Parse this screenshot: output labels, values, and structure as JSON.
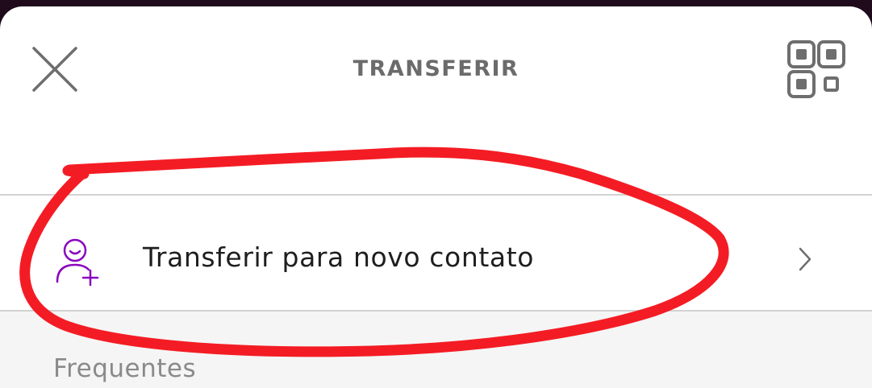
{
  "header": {
    "title": "TRANSFERIR",
    "close_icon": "close-icon",
    "qr_icon": "qr-code-icon"
  },
  "new_contact_row": {
    "label": "Transferir para novo contato",
    "icon": "add-person-icon",
    "chevron": "chevron-right-icon"
  },
  "frequent_section": {
    "title": "Frequentes"
  },
  "colors": {
    "accent": "#8a05be",
    "annotation": "#f41c24",
    "background_top": "#1f0b1c"
  }
}
